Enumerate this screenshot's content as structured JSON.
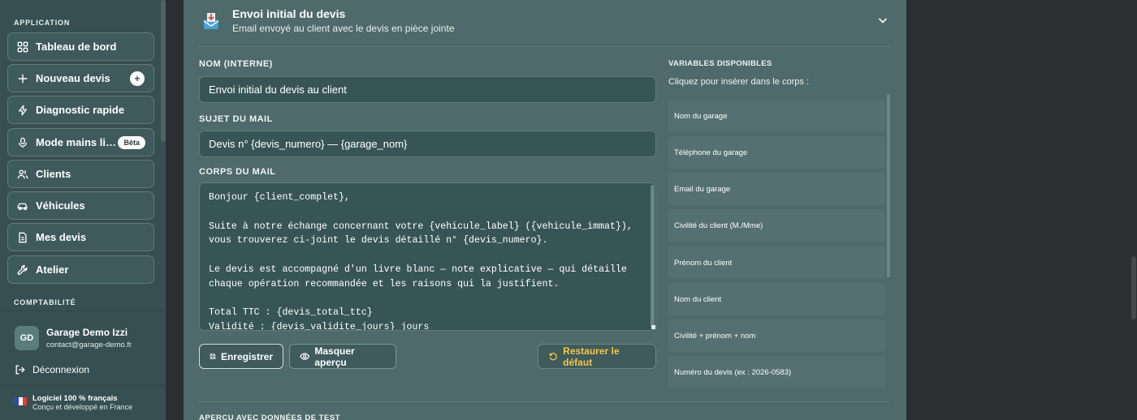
{
  "sidebar": {
    "section_app": "APPLICATION",
    "items": [
      {
        "label": "Tableau de bord",
        "icon": "dashboard-icon"
      },
      {
        "label": "Nouveau devis",
        "icon": "plus-icon",
        "badge": "+"
      },
      {
        "label": "Diagnostic rapide",
        "icon": "lightning-icon"
      },
      {
        "label": "Mode mains libres",
        "icon": "microphone-icon",
        "badge": "Bêta"
      },
      {
        "label": "Clients",
        "icon": "users-icon"
      },
      {
        "label": "Véhicules",
        "icon": "car-icon"
      },
      {
        "label": "Mes devis",
        "icon": "document-icon"
      },
      {
        "label": "Atelier",
        "icon": "wrench-icon"
      }
    ],
    "section_compta": "COMPTABILITÉ",
    "user": {
      "initials": "GD",
      "name": "Garage Demo Izzi",
      "email": "contact@garage-demo.fr"
    },
    "logout_label": "Déconnexion",
    "footer": {
      "title": "Logiciel 100 % français",
      "subtitle": "Conçu et développé en France"
    }
  },
  "template": {
    "title": "Envoi initial du devis",
    "subtitle": "Email envoyé au client avec le devis en pièce jointe",
    "name_label": "NOM (INTERNE)",
    "name_value": "Envoi initial du devis au client",
    "subject_label": "SUJET DU MAIL",
    "subject_value": "Devis n° {devis_numero} — {garage_nom}",
    "body_label": "CORPS DU MAIL",
    "body_value": "Bonjour {client_complet},\n\nSuite à notre échange concernant votre {vehicule_label} ({vehicule_immat}), vous trouverez ci-joint le devis détaillé n° {devis_numero}.\n\nLe devis est accompagné d'un livre blanc — note explicative — qui détaille chaque opération recommandée et les raisons qui la justifient.\n\nTotal TTC : {devis_total_ttc}\nValidité : {devis_validite_jours} jours",
    "save_label": "Enregistrer",
    "preview_label": "Masquer aperçu",
    "restore_label": "Restaurer le défaut",
    "preview_section_label": "APERÇU AVEC DONNÉES DE TEST"
  },
  "variables": {
    "title": "VARIABLES DISPONIBLES",
    "hint": "Cliquez pour insérer dans le corps :",
    "items": [
      "Nom du garage",
      "Téléphone du garage",
      "Email du garage",
      "Civilité du client (M./Mme)",
      "Prénom du client",
      "Nom du client",
      "Civilité + prénom + nom",
      "Numéro du devis (ex : 2026-0583)"
    ]
  },
  "colors": {
    "accent_warning": "#f3c54b",
    "sidebar_bg": "#365052",
    "panel_bg": "#4e6a6a"
  }
}
